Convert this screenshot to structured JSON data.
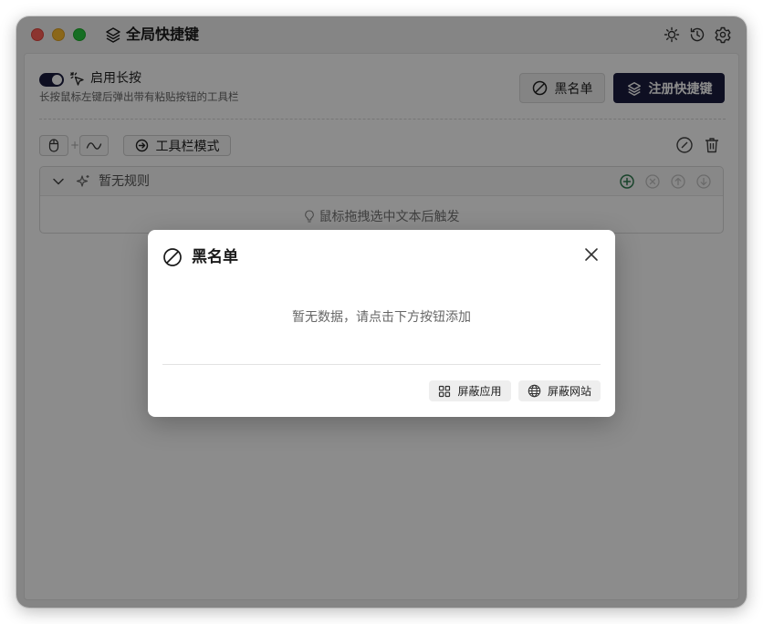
{
  "window": {
    "title": "全局快捷键",
    "app_icon": "layers-icon"
  },
  "titlebar_icons": [
    "sun-icon",
    "history-icon",
    "gear-icon"
  ],
  "long_press": {
    "enabled": true,
    "label": "启用长按",
    "description": "长按鼠标左键后弹出带有粘贴按钮的工具栏"
  },
  "header_buttons": {
    "blacklist": "黑名单",
    "register": "注册快捷键"
  },
  "trigger": {
    "plus": "+",
    "toolbar_mode": "工具栏模式"
  },
  "rule_panel": {
    "empty_title": "暂无规则",
    "hint": "鼠标拖拽选中文本后触发"
  },
  "modal": {
    "title": "黑名单",
    "empty_text": "暂无数据，请点击下方按钮添加",
    "btn_block_app": "屏蔽应用",
    "btn_block_site": "屏蔽网站"
  },
  "colors": {
    "primary": "#1b1c3e",
    "success": "#2e7d4f",
    "overlay": "rgba(0,0,0,0.45)"
  }
}
